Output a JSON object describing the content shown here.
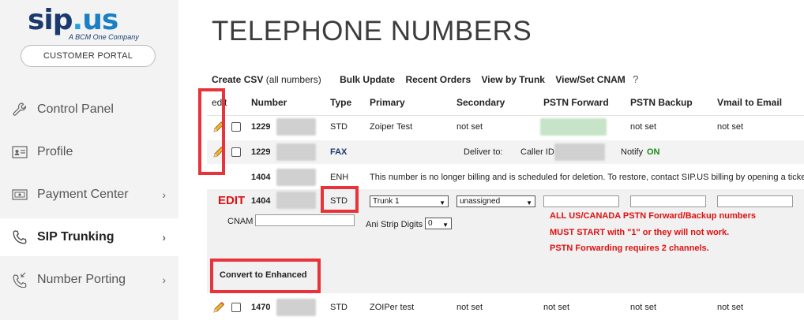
{
  "sidebar": {
    "logo_brand": "sip.us",
    "logo_tagline": "A BCM One Company",
    "portal_button": "CUSTOMER PORTAL",
    "items": [
      {
        "label": "Control Panel",
        "icon": "wrench-icon"
      },
      {
        "label": "Profile",
        "icon": "id-card-icon"
      },
      {
        "label": "Payment Center",
        "icon": "payment-icon",
        "chevron": "›"
      },
      {
        "label": "SIP Trunking",
        "icon": "phone-icon",
        "chevron": "›"
      },
      {
        "label": "Number Porting",
        "icon": "phone-incoming-icon",
        "chevron": "›"
      }
    ],
    "active_index": 3
  },
  "main": {
    "title": "TELEPHONE NUMBERS",
    "links": {
      "create_csv": "Create CSV",
      "create_csv_note": "(all numbers)",
      "bulk_update": "Bulk Update",
      "recent_orders": "Recent Orders",
      "view_by_trunk": "View by Trunk",
      "view_set_cnam": "View/Set CNAM",
      "help": "?"
    },
    "columns": {
      "edit": "edit",
      "number": "Number",
      "type": "Type",
      "primary": "Primary",
      "secondary": "Secondary",
      "pstn_forward": "PSTN Forward",
      "pstn_backup": "PSTN Backup",
      "vmail": "Vmail to Email"
    },
    "rows": [
      {
        "number": "1229",
        "type": "STD",
        "primary": "Zoiper Test",
        "secondary": "not set",
        "pstn_backup": "not set",
        "vmail": "not set"
      },
      {
        "number": "1229",
        "type": "FAX",
        "deliver_to": "Deliver to:",
        "caller_id": "Caller ID",
        "notify": "Notify",
        "notify_state": "ON"
      },
      {
        "number": "1404",
        "type": "ENH",
        "message": "This number is no longer billing and is scheduled for deletion. To restore, contact SIP.US billing by opening a ticket"
      },
      {
        "number": "1470",
        "type": "STD",
        "primary": "ZOIPer test",
        "secondary": "not set",
        "pstn_forward": "not set",
        "pstn_backup": "not set",
        "vmail": "not set"
      }
    ],
    "edit_row": {
      "label": "EDIT",
      "number": "1404",
      "type": "STD",
      "primary_select": "Trunk 1",
      "secondary_select": "unassigned",
      "cnam_label": "CNAM",
      "ani_label": "Ani Strip Digits",
      "ani_value": "0",
      "warnings": [
        "ALL US/CANADA PSTN Forward/Backup numbers",
        "MUST START with \"1\" or they will not work.",
        "PSTN Forwarding requires 2 channels."
      ],
      "convert_button": "Convert to Enhanced"
    }
  },
  "colors": {
    "accent_red": "#e8333a",
    "warning_red": "#e01010",
    "on_green": "#1a8a1a",
    "brand_navy": "#1a3a6e"
  }
}
